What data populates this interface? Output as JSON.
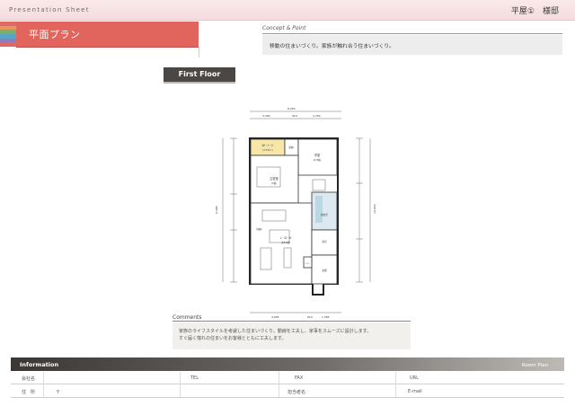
{
  "header": {
    "title": "Presentation Sheet",
    "right": "平屋①　様邸"
  },
  "title_band": {
    "title": "平面プラン",
    "stripe_colors": [
      "#e06a63",
      "#e39a5a",
      "#77b06b",
      "#5aa3c8",
      "#8f7cbc",
      "#e06a63"
    ]
  },
  "concept": {
    "label": "Concept & Point",
    "text": "移動の住まいづくり。家族が触れ合う住まいづくり。"
  },
  "floor_tab": {
    "label": "First Floor"
  },
  "plan": {
    "rooms": [
      "W・I・C\n(2.75m²)",
      "収納",
      "洋室\n(4.5帖)",
      "主寝室\n(7帖)",
      "脱衣室",
      "L・D・K\n(18.5帖)",
      "浴室",
      "玄関",
      "トイレ",
      "冷蔵庫"
    ],
    "dims_top": [
      "8,250",
      "3,390",
      "910",
      "2,700"
    ],
    "dims_bottom": [
      "4,095",
      "910",
      "1,365"
    ],
    "dims_left": [
      "2,005",
      "2,005",
      "1,820",
      "910",
      "2,900"
    ],
    "dims_right": [
      "2,730",
      "3,640",
      "1,820",
      "1,300"
    ],
    "dims_total": [
      "9,490",
      "10,010"
    ]
  },
  "comments": {
    "label": "Comments",
    "lines": [
      "家族のライフスタイルを考慮した住まいづくり。動線を工夫し、家事をスムーズに設計します。",
      "すぐ届く憧れの住まいをお客様とともに工夫します。"
    ]
  },
  "info": {
    "label": "Information",
    "room": "Room Plan",
    "row1": [
      "会社名",
      "TEL",
      "FAX",
      "URL"
    ],
    "row2": [
      "住　所",
      "〒",
      "担当者名",
      "E-mail"
    ]
  }
}
